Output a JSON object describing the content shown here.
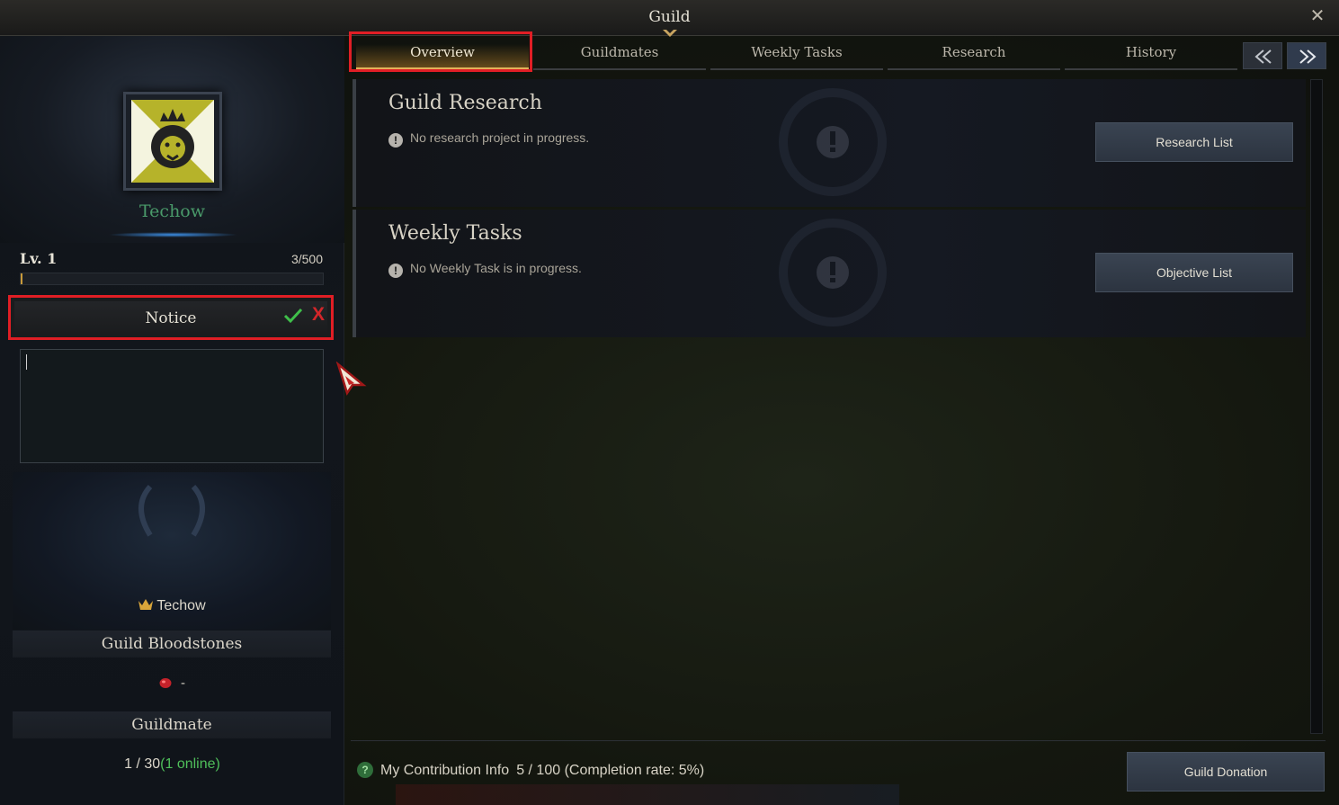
{
  "window": {
    "title": "Guild",
    "close_icon": "close-icon"
  },
  "guild": {
    "name": "Techow",
    "level_label": "Lv. 1",
    "exp_text": "3/500",
    "exp_progress": 0.006,
    "emblem_icon": "lion-crown-emblem-icon",
    "emblem_color": "#b6b32a"
  },
  "notice": {
    "label": "Notice",
    "confirm_icon": "checkmark-icon",
    "cancel_label": "X",
    "input_value": ""
  },
  "master": {
    "name": "Techow",
    "icon": "crown-icon"
  },
  "bloodstones": {
    "header": "Guild Bloodstones",
    "value": "-",
    "icon": "bloodstone-icon"
  },
  "guildmates": {
    "header": "Guildmate",
    "count": "1 / 30",
    "online": "(1 online)"
  },
  "tabs": [
    {
      "label": "Overview",
      "active": true
    },
    {
      "label": "Guildmates",
      "active": false
    },
    {
      "label": "Weekly Tasks",
      "active": false
    },
    {
      "label": "Research",
      "active": false
    },
    {
      "label": "History",
      "active": false
    }
  ],
  "tab_nav": {
    "prev_icon": "double-chevron-left-icon",
    "next_icon": "double-chevron-right-icon"
  },
  "panels": {
    "research": {
      "title": "Guild Research",
      "status": "No research project in progress.",
      "button": "Research List"
    },
    "weekly": {
      "title": "Weekly Tasks",
      "status": "No Weekly Task is in progress.",
      "button": "Objective List"
    }
  },
  "contribution": {
    "help_icon": "?",
    "label": "My Contribution Info",
    "value": "5 / 100 (Completion rate: 5%)"
  },
  "donation_button": "Guild Donation",
  "colors": {
    "highlight": "#e01e25",
    "accent_gold": "#e2b25a",
    "online_green": "#4fbf5a",
    "guild_name": "#4a9a6a"
  }
}
